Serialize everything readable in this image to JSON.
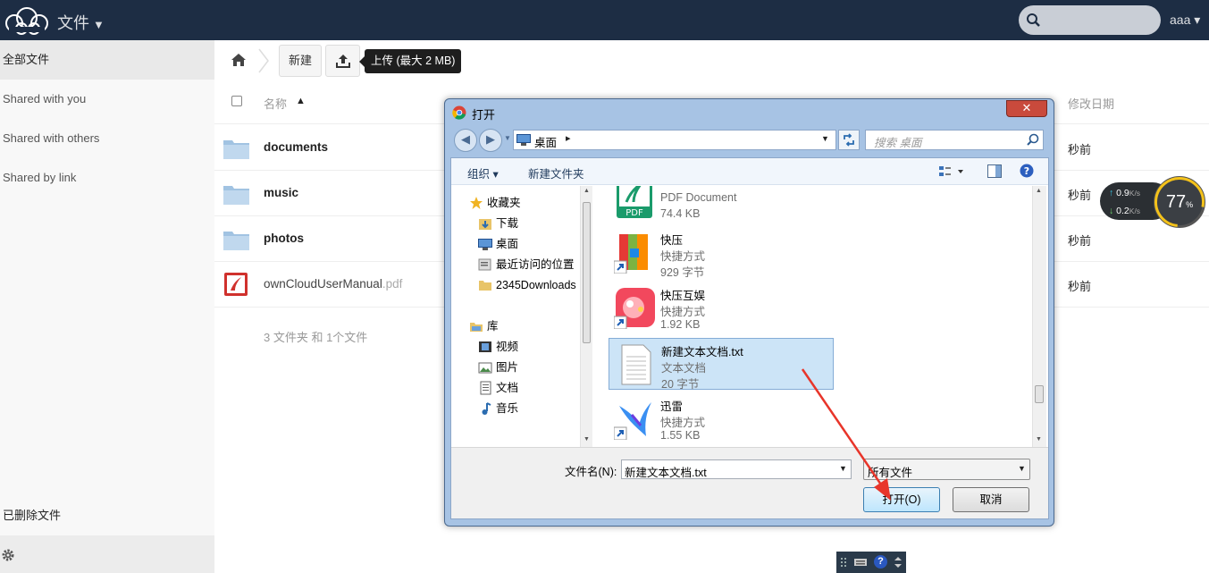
{
  "header": {
    "app_title": "文件",
    "user": "aaa"
  },
  "sidebar": {
    "items": [
      {
        "label": "全部文件"
      },
      {
        "label": "Shared with you"
      },
      {
        "label": "Shared with others"
      },
      {
        "label": "Shared by link"
      }
    ],
    "deleted": "已删除文件"
  },
  "controls": {
    "new_label": "新建",
    "upload_tooltip": "上传 (最大 2 MB)"
  },
  "file_list": {
    "col_name": "名称",
    "col_modified": "修改日期",
    "rows": [
      {
        "name": "documents",
        "date": "秒前"
      },
      {
        "name": "music",
        "date": "秒前"
      },
      {
        "name": "photos",
        "date": "秒前"
      },
      {
        "name": "ownCloudUserManual",
        "ext": ".pdf",
        "date": "秒前"
      }
    ],
    "summary": "3 文件夹 和 1个文件"
  },
  "network_widget": {
    "up": "0.9",
    "down": "0.2",
    "unit": "K/s",
    "percent": "77",
    "percent_sign": "%"
  },
  "dialog": {
    "title": "打开",
    "close": "✕",
    "address": "桌面",
    "search_placeholder": "搜索 桌面",
    "toolbar": {
      "organize": "组织 ▾",
      "new_folder": "新建文件夹"
    },
    "tree": [
      {
        "label": "收藏夹"
      },
      {
        "label": "下载"
      },
      {
        "label": "桌面"
      },
      {
        "label": "最近访问的位置"
      },
      {
        "label": "2345Downloads"
      },
      {
        "label": "库"
      },
      {
        "label": "视频"
      },
      {
        "label": "图片"
      },
      {
        "label": "文档"
      },
      {
        "label": "音乐"
      }
    ],
    "files": [
      {
        "name": "",
        "type": "PDF Document",
        "size": "74.4 KB"
      },
      {
        "name": "快压",
        "type": "快捷方式",
        "size": "929 字节"
      },
      {
        "name": "快压互娱",
        "type": "快捷方式",
        "size": "1.92 KB"
      },
      {
        "name": "新建文本文档.txt",
        "type": "文本文档",
        "size": "20 字节"
      },
      {
        "name": "迅雷",
        "type": "快捷方式",
        "size": "1.55 KB"
      }
    ],
    "filename_label": "文件名(N):",
    "filename_value": "新建文本文档.txt",
    "filetype_value": "所有文件",
    "open_button": "打开(O)",
    "cancel_button": "取消"
  },
  "colors": {
    "header_bg": "#1d2d44",
    "annotation_arrow": "#e8352a"
  }
}
